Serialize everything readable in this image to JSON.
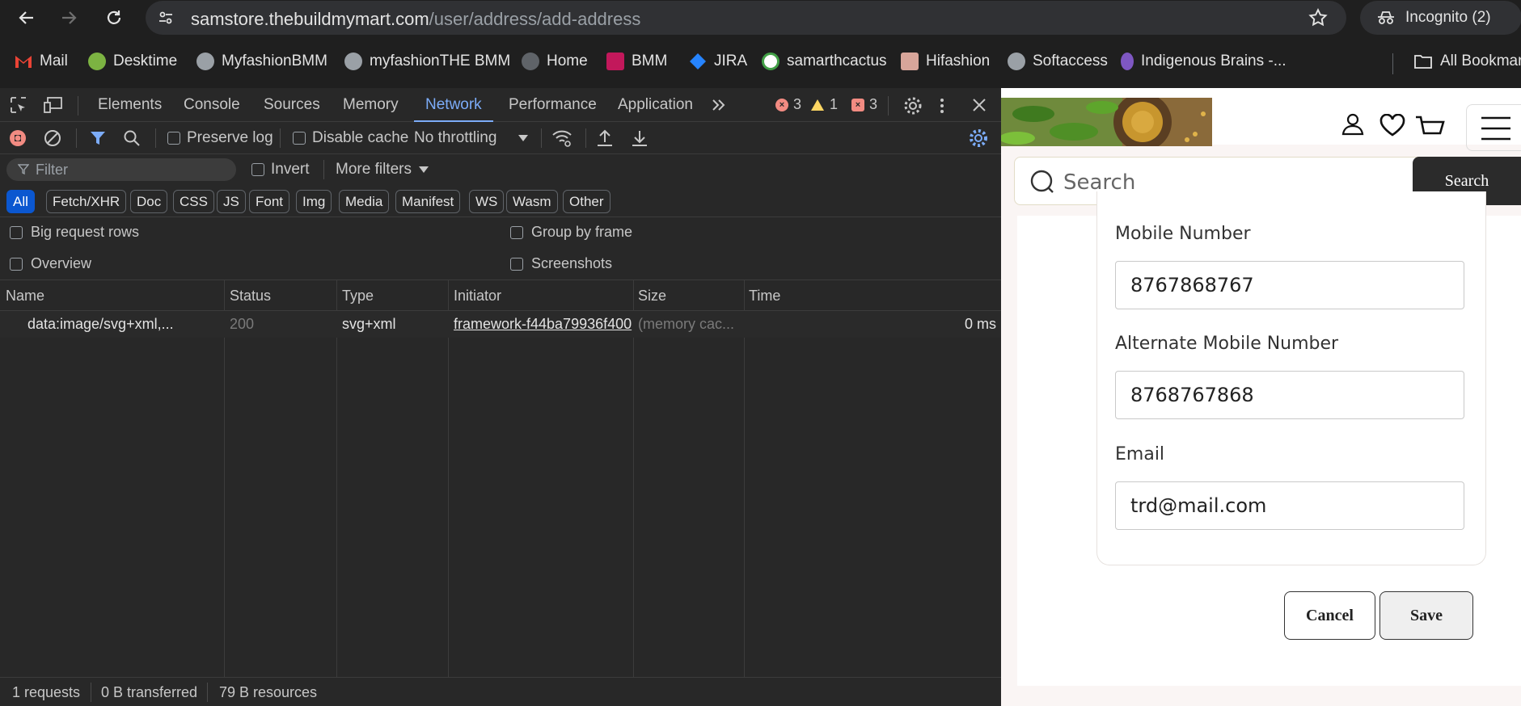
{
  "browser": {
    "url_host": "samstore.thebuildmymart.com",
    "url_path": "/user/address/add-address",
    "incognito_label": "Incognito (2)",
    "bookmarks": [
      {
        "label": "Mail",
        "color": "#ea4335"
      },
      {
        "label": "Desktime",
        "color": "#7cb342"
      },
      {
        "label": "MyfashionBMM",
        "color": "#9aa0a6"
      },
      {
        "label": "myfashionTHE BMM",
        "color": "#9aa0a6"
      },
      {
        "label": "Home",
        "color": "#5f6368"
      },
      {
        "label": "BMM",
        "color": "#c2185b"
      },
      {
        "label": "JIRA",
        "color": "#2684ff"
      },
      {
        "label": "samarthcactus",
        "color": "#43a047"
      },
      {
        "label": "Hifashion",
        "color": "#d7a59a"
      },
      {
        "label": "Softaccess",
        "color": "#9aa0a6"
      },
      {
        "label": "Indigenous Brains -...",
        "color": "#7e57c2"
      }
    ],
    "all_bookmarks_label": "All Bookmarks"
  },
  "devtools": {
    "tabs": [
      "Elements",
      "Console",
      "Sources",
      "Memory",
      "Network",
      "Performance",
      "Application"
    ],
    "active_tab": "Network",
    "errors": "3",
    "warnings": "1",
    "issues": "3",
    "toolbar": {
      "preserve_log": "Preserve log",
      "disable_cache": "Disable cache",
      "throttling": "No throttling"
    },
    "filter": {
      "placeholder": "Filter",
      "invert": "Invert",
      "more_filters": "More filters"
    },
    "types": [
      "All",
      "Fetch/XHR",
      "Doc",
      "CSS",
      "JS",
      "Font",
      "Img",
      "Media",
      "Manifest",
      "WS",
      "Wasm",
      "Other"
    ],
    "options": {
      "big_rows": "Big request rows",
      "group_by_frame": "Group by frame",
      "overview": "Overview",
      "screenshots": "Screenshots"
    },
    "columns": [
      "Name",
      "Status",
      "Type",
      "Initiator",
      "Size",
      "Time"
    ],
    "rows": [
      {
        "name": "data:image/svg+xml,...",
        "status": "200",
        "type": "svg+xml",
        "initiator": "framework-f44ba79936f400",
        "size": "(memory cac...",
        "time": "0 ms"
      }
    ],
    "status": {
      "requests": "1 requests",
      "transferred": "0 B transferred",
      "resources": "79 B resources"
    }
  },
  "page": {
    "search_placeholder": "Search",
    "search_button": "Search",
    "fields": {
      "mobile_label": "Mobile Number",
      "mobile_value": "8767868767",
      "alt_mobile_label": "Alternate Mobile Number",
      "alt_mobile_value": "8768767868",
      "email_label": "Email",
      "email_value": "trd@mail.com"
    },
    "cancel_label": "Cancel",
    "save_label": "Save"
  }
}
